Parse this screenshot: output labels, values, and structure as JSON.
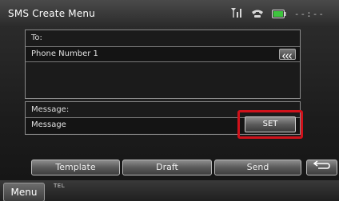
{
  "app": {
    "title": "SMS Create Menu"
  },
  "status_bar": {
    "signal_icon": "signal-bars-icon",
    "phone_icon": "phone-connected-icon",
    "battery_icon": "battery-icon",
    "clock": "--:--"
  },
  "to_field": {
    "label": "To:",
    "value": "Phone Number 1",
    "contacts_button_icon": "triple-chevron-left-icon"
  },
  "message_field": {
    "label": "Message:",
    "value": "Message",
    "set_button_label": "SET"
  },
  "toolbar": {
    "template_label": "Template",
    "draft_label": "Draft",
    "send_label": "Send",
    "back_icon": "return-arrow-icon"
  },
  "bottom_bar": {
    "menu_label": "Menu",
    "source_label": "TEL"
  },
  "colors": {
    "highlight": "#d0121b",
    "background": "#1c1c1c",
    "battery": "#3ec43e"
  }
}
